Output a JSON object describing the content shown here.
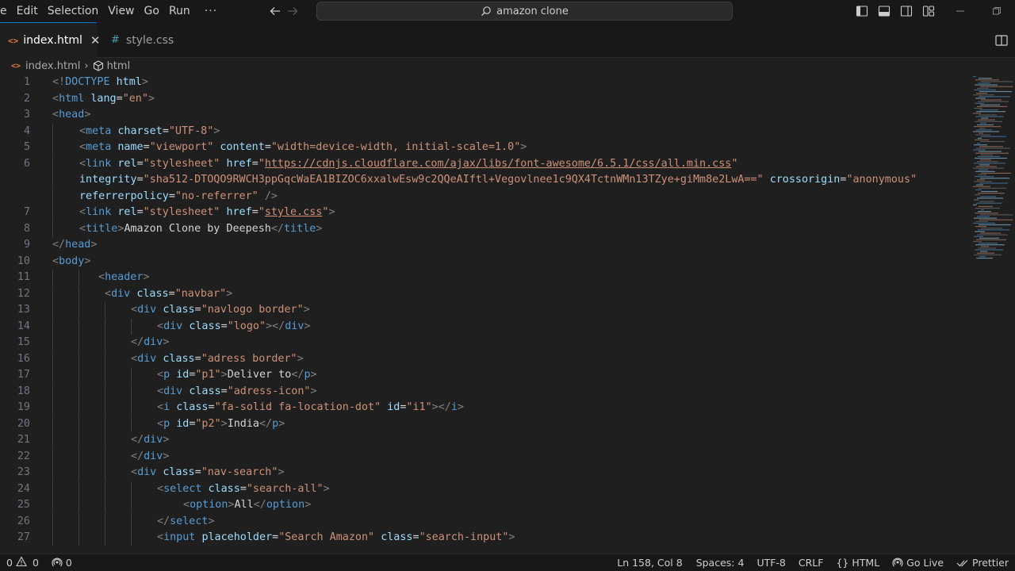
{
  "menu": [
    "e",
    "Edit",
    "Selection",
    "View",
    "Go",
    "Run",
    "···"
  ],
  "command_center": {
    "text": "amazon clone"
  },
  "tabs": [
    {
      "name": "index.html",
      "active": true
    },
    {
      "name": "style.css",
      "active": false
    }
  ],
  "breadcrumb": {
    "file": "index.html",
    "symbol": "html"
  },
  "code_lines": [
    {
      "n": "1",
      "indent": 0,
      "tokens": [
        [
          "pun",
          "<!"
        ],
        [
          "tag",
          "DOCTYPE"
        ],
        [
          "txt",
          " "
        ],
        [
          "att",
          "html"
        ],
        [
          "pun",
          ">"
        ]
      ]
    },
    {
      "n": "2",
      "indent": 0,
      "tokens": [
        [
          "pun",
          "<"
        ],
        [
          "tag",
          "html"
        ],
        [
          "txt",
          " "
        ],
        [
          "att",
          "lang"
        ],
        [
          "txt",
          "="
        ],
        [
          "str",
          "\"en\""
        ],
        [
          "pun",
          ">"
        ]
      ]
    },
    {
      "n": "3",
      "indent": 0,
      "tokens": [
        [
          "pun",
          "<"
        ],
        [
          "tag",
          "head"
        ],
        [
          "pun",
          ">"
        ]
      ]
    },
    {
      "n": "4",
      "indent": 34,
      "tokens": [
        [
          "pun",
          "<"
        ],
        [
          "tag",
          "meta"
        ],
        [
          "txt",
          " "
        ],
        [
          "att",
          "charset"
        ],
        [
          "txt",
          "="
        ],
        [
          "str",
          "\"UTF-8\""
        ],
        [
          "pun",
          ">"
        ]
      ]
    },
    {
      "n": "5",
      "indent": 34,
      "tokens": [
        [
          "pun",
          "<"
        ],
        [
          "tag",
          "meta"
        ],
        [
          "txt",
          " "
        ],
        [
          "att",
          "name"
        ],
        [
          "txt",
          "="
        ],
        [
          "str",
          "\"viewport\""
        ],
        [
          "txt",
          " "
        ],
        [
          "att",
          "content"
        ],
        [
          "txt",
          "="
        ],
        [
          "str",
          "\"width=device-width, initial-scale=1.0\""
        ],
        [
          "pun",
          ">"
        ]
      ]
    },
    {
      "n": "6",
      "indent": 34,
      "tokens": [
        [
          "pun",
          "<"
        ],
        [
          "tag",
          "link"
        ],
        [
          "txt",
          " "
        ],
        [
          "att",
          "rel"
        ],
        [
          "txt",
          "="
        ],
        [
          "str",
          "\"stylesheet\""
        ],
        [
          "txt",
          " "
        ],
        [
          "att",
          "href"
        ],
        [
          "txt",
          "="
        ],
        [
          "str",
          "\""
        ],
        [
          "link",
          "https://cdnjs.cloudflare.com/ajax/libs/font-awesome/6.5.1/css/all.min.css"
        ],
        [
          "str",
          "\""
        ]
      ]
    },
    {
      "n": "",
      "indent": 34,
      "tokens": [
        [
          "att",
          "integrity"
        ],
        [
          "txt",
          "="
        ],
        [
          "str",
          "\"sha512-DTOQO9RWCH3ppGqcWaEA1BIZOC6xxalwEsw9c2QQeAIftl+Vegovlnee1c9QX4TctnWMn13TZye+giMm8e2LwA==\""
        ],
        [
          "txt",
          " "
        ],
        [
          "att",
          "crossorigin"
        ],
        [
          "txt",
          "="
        ],
        [
          "str",
          "\"anonymous\""
        ]
      ]
    },
    {
      "n": "",
      "indent": 34,
      "tokens": [
        [
          "att",
          "referrerpolicy"
        ],
        [
          "txt",
          "="
        ],
        [
          "str",
          "\"no-referrer\""
        ],
        [
          "txt",
          " "
        ],
        [
          "pun",
          "/>"
        ]
      ]
    },
    {
      "n": "7",
      "indent": 34,
      "tokens": [
        [
          "pun",
          "<"
        ],
        [
          "tag",
          "link"
        ],
        [
          "txt",
          " "
        ],
        [
          "att",
          "rel"
        ],
        [
          "txt",
          "="
        ],
        [
          "str",
          "\"stylesheet\""
        ],
        [
          "txt",
          " "
        ],
        [
          "att",
          "href"
        ],
        [
          "txt",
          "="
        ],
        [
          "str",
          "\""
        ],
        [
          "link",
          "style.css"
        ],
        [
          "str",
          "\""
        ],
        [
          "pun",
          ">"
        ]
      ]
    },
    {
      "n": "8",
      "indent": 34,
      "tokens": [
        [
          "pun",
          "<"
        ],
        [
          "tag",
          "title"
        ],
        [
          "pun",
          ">"
        ],
        [
          "txt",
          "Amazon Clone by Deepesh"
        ],
        [
          "pun",
          "</"
        ],
        [
          "tag",
          "title"
        ],
        [
          "pun",
          ">"
        ]
      ]
    },
    {
      "n": "9",
      "indent": 0,
      "tokens": [
        [
          "pun",
          "</"
        ],
        [
          "tag",
          "head"
        ],
        [
          "pun",
          ">"
        ]
      ]
    },
    {
      "n": "10",
      "indent": 0,
      "tokens": [
        [
          "pun",
          "<"
        ],
        [
          "tag",
          "body"
        ],
        [
          "pun",
          ">"
        ]
      ]
    },
    {
      "n": "11",
      "indent": 58,
      "tokens": [
        [
          "pun",
          "<"
        ],
        [
          "tag",
          "header"
        ],
        [
          "pun",
          ">"
        ]
      ]
    },
    {
      "n": "12",
      "indent": 66,
      "tokens": [
        [
          "pun",
          "<"
        ],
        [
          "tag",
          "div"
        ],
        [
          "txt",
          " "
        ],
        [
          "att",
          "class"
        ],
        [
          "txt",
          "="
        ],
        [
          "str",
          "\"navbar\""
        ],
        [
          "pun",
          ">"
        ]
      ]
    },
    {
      "n": "13",
      "indent": 99,
      "tokens": [
        [
          "pun",
          "<"
        ],
        [
          "tag",
          "div"
        ],
        [
          "txt",
          " "
        ],
        [
          "att",
          "class"
        ],
        [
          "txt",
          "="
        ],
        [
          "str",
          "\"navlogo border\""
        ],
        [
          "pun",
          ">"
        ]
      ]
    },
    {
      "n": "14",
      "indent": 132,
      "tokens": [
        [
          "pun",
          "<"
        ],
        [
          "tag",
          "div"
        ],
        [
          "txt",
          " "
        ],
        [
          "att",
          "class"
        ],
        [
          "txt",
          "="
        ],
        [
          "str",
          "\"logo\""
        ],
        [
          "pun",
          "></"
        ],
        [
          "tag",
          "div"
        ],
        [
          "pun",
          ">"
        ]
      ]
    },
    {
      "n": "15",
      "indent": 99,
      "tokens": [
        [
          "pun",
          "</"
        ],
        [
          "tag",
          "div"
        ],
        [
          "pun",
          ">"
        ]
      ]
    },
    {
      "n": "16",
      "indent": 99,
      "tokens": [
        [
          "pun",
          "<"
        ],
        [
          "tag",
          "div"
        ],
        [
          "txt",
          " "
        ],
        [
          "att",
          "class"
        ],
        [
          "txt",
          "="
        ],
        [
          "str",
          "\"adress border\""
        ],
        [
          "pun",
          ">"
        ]
      ]
    },
    {
      "n": "17",
      "indent": 132,
      "tokens": [
        [
          "pun",
          "<"
        ],
        [
          "tag",
          "p"
        ],
        [
          "txt",
          " "
        ],
        [
          "att",
          "id"
        ],
        [
          "txt",
          "="
        ],
        [
          "str",
          "\"p1\""
        ],
        [
          "pun",
          ">"
        ],
        [
          "txt",
          "Deliver to"
        ],
        [
          "pun",
          "</"
        ],
        [
          "tag",
          "p"
        ],
        [
          "pun",
          ">"
        ]
      ]
    },
    {
      "n": "18",
      "indent": 132,
      "tokens": [
        [
          "pun",
          "<"
        ],
        [
          "tag",
          "div"
        ],
        [
          "txt",
          " "
        ],
        [
          "att",
          "class"
        ],
        [
          "txt",
          "="
        ],
        [
          "str",
          "\"adress-icon\""
        ],
        [
          "pun",
          ">"
        ]
      ]
    },
    {
      "n": "19",
      "indent": 132,
      "tokens": [
        [
          "pun",
          "<"
        ],
        [
          "tag",
          "i"
        ],
        [
          "txt",
          " "
        ],
        [
          "att",
          "class"
        ],
        [
          "txt",
          "="
        ],
        [
          "str",
          "\"fa-solid fa-location-dot\""
        ],
        [
          "txt",
          " "
        ],
        [
          "att",
          "id"
        ],
        [
          "txt",
          "="
        ],
        [
          "str",
          "\"i1\""
        ],
        [
          "pun",
          "></"
        ],
        [
          "tag",
          "i"
        ],
        [
          "pun",
          ">"
        ]
      ]
    },
    {
      "n": "20",
      "indent": 132,
      "tokens": [
        [
          "pun",
          "<"
        ],
        [
          "tag",
          "p"
        ],
        [
          "txt",
          " "
        ],
        [
          "att",
          "id"
        ],
        [
          "txt",
          "="
        ],
        [
          "str",
          "\"p2\""
        ],
        [
          "pun",
          ">"
        ],
        [
          "txt",
          "India"
        ],
        [
          "pun",
          "</"
        ],
        [
          "tag",
          "p"
        ],
        [
          "pun",
          ">"
        ]
      ]
    },
    {
      "n": "21",
      "indent": 99,
      "tokens": [
        [
          "pun",
          "</"
        ],
        [
          "tag",
          "div"
        ],
        [
          "pun",
          ">"
        ]
      ]
    },
    {
      "n": "22",
      "indent": 99,
      "tokens": [
        [
          "pun",
          "</"
        ],
        [
          "tag",
          "div"
        ],
        [
          "pun",
          ">"
        ]
      ]
    },
    {
      "n": "23",
      "indent": 99,
      "tokens": [
        [
          "pun",
          "<"
        ],
        [
          "tag",
          "div"
        ],
        [
          "txt",
          " "
        ],
        [
          "att",
          "class"
        ],
        [
          "txt",
          "="
        ],
        [
          "str",
          "\"nav-search\""
        ],
        [
          "pun",
          ">"
        ]
      ]
    },
    {
      "n": "24",
      "indent": 132,
      "tokens": [
        [
          "pun",
          "<"
        ],
        [
          "tag",
          "select"
        ],
        [
          "txt",
          " "
        ],
        [
          "att",
          "class"
        ],
        [
          "txt",
          "="
        ],
        [
          "str",
          "\"search-all\""
        ],
        [
          "pun",
          ">"
        ]
      ]
    },
    {
      "n": "25",
      "indent": 165,
      "tokens": [
        [
          "pun",
          "<"
        ],
        [
          "tag",
          "option"
        ],
        [
          "pun",
          ">"
        ],
        [
          "txt",
          "All"
        ],
        [
          "pun",
          "</"
        ],
        [
          "tag",
          "option"
        ],
        [
          "pun",
          ">"
        ]
      ]
    },
    {
      "n": "26",
      "indent": 132,
      "tokens": [
        [
          "pun",
          "</"
        ],
        [
          "tag",
          "select"
        ],
        [
          "pun",
          ">"
        ]
      ]
    },
    {
      "n": "27",
      "indent": 132,
      "tokens": [
        [
          "pun",
          "<"
        ],
        [
          "tag",
          "input"
        ],
        [
          "txt",
          " "
        ],
        [
          "att",
          "placeholder"
        ],
        [
          "txt",
          "="
        ],
        [
          "str",
          "\"Search Amazon\""
        ],
        [
          "txt",
          " "
        ],
        [
          "att",
          "class"
        ],
        [
          "txt",
          "="
        ],
        [
          "str",
          "\"search-input\""
        ],
        [
          "pun",
          ">"
        ]
      ]
    }
  ],
  "status": {
    "errors": "0",
    "warnings": "0",
    "ports": "0",
    "position": "Ln 158, Col 8",
    "spaces": "Spaces: 4",
    "encoding": "UTF-8",
    "eol": "CRLF",
    "language": "HTML",
    "golive": "Go Live",
    "prettier": "Prettier"
  },
  "colors": {
    "tag": "#569cd6",
    "attr": "#9cdcfe",
    "string": "#ce9178",
    "text": "#d4d4d4",
    "punct": "#808080",
    "accent": "#0078d4"
  }
}
